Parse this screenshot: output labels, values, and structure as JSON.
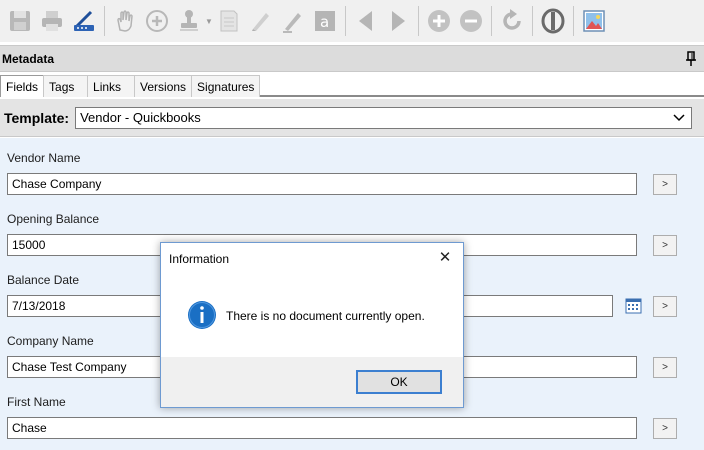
{
  "toolbar": {
    "icons": [
      "save-icon",
      "print-icon",
      "scanner-icon",
      "hand-pan-icon",
      "zoom-in-hand-icon",
      "stamp-icon",
      "note-icon",
      "highlighter-icon",
      "pen-icon",
      "text-annotation-icon",
      "previous-page-icon",
      "next-page-icon",
      "zoom-in-icon",
      "zoom-out-icon",
      "rotate-icon",
      "redact-icon",
      "image-icon"
    ]
  },
  "panel": {
    "title": "Metadata"
  },
  "tabs": [
    {
      "label": "Fields",
      "active": true
    },
    {
      "label": "Tags"
    },
    {
      "label": "Links"
    },
    {
      "label": "Versions"
    },
    {
      "label": "Signatures"
    }
  ],
  "template": {
    "label": "Template:",
    "value": "Vendor - Quickbooks"
  },
  "fields": [
    {
      "label": "Vendor Name",
      "value": "Chase Company",
      "button": ">"
    },
    {
      "label": "Opening Balance",
      "value": "15000",
      "button": ">"
    },
    {
      "label": "Balance Date",
      "value": "7/13/2018",
      "button": ">"
    },
    {
      "label": "Company Name",
      "value": "Chase Test Company",
      "button": ">"
    },
    {
      "label": "First Name",
      "value": "Chase",
      "button": ">"
    }
  ],
  "dialog": {
    "title": "Information",
    "close": "✕",
    "message": "There is no document currently open.",
    "ok": "OK"
  },
  "colors": {
    "accent": "#1a6fc4",
    "form_bg": "#eaf2fb"
  }
}
